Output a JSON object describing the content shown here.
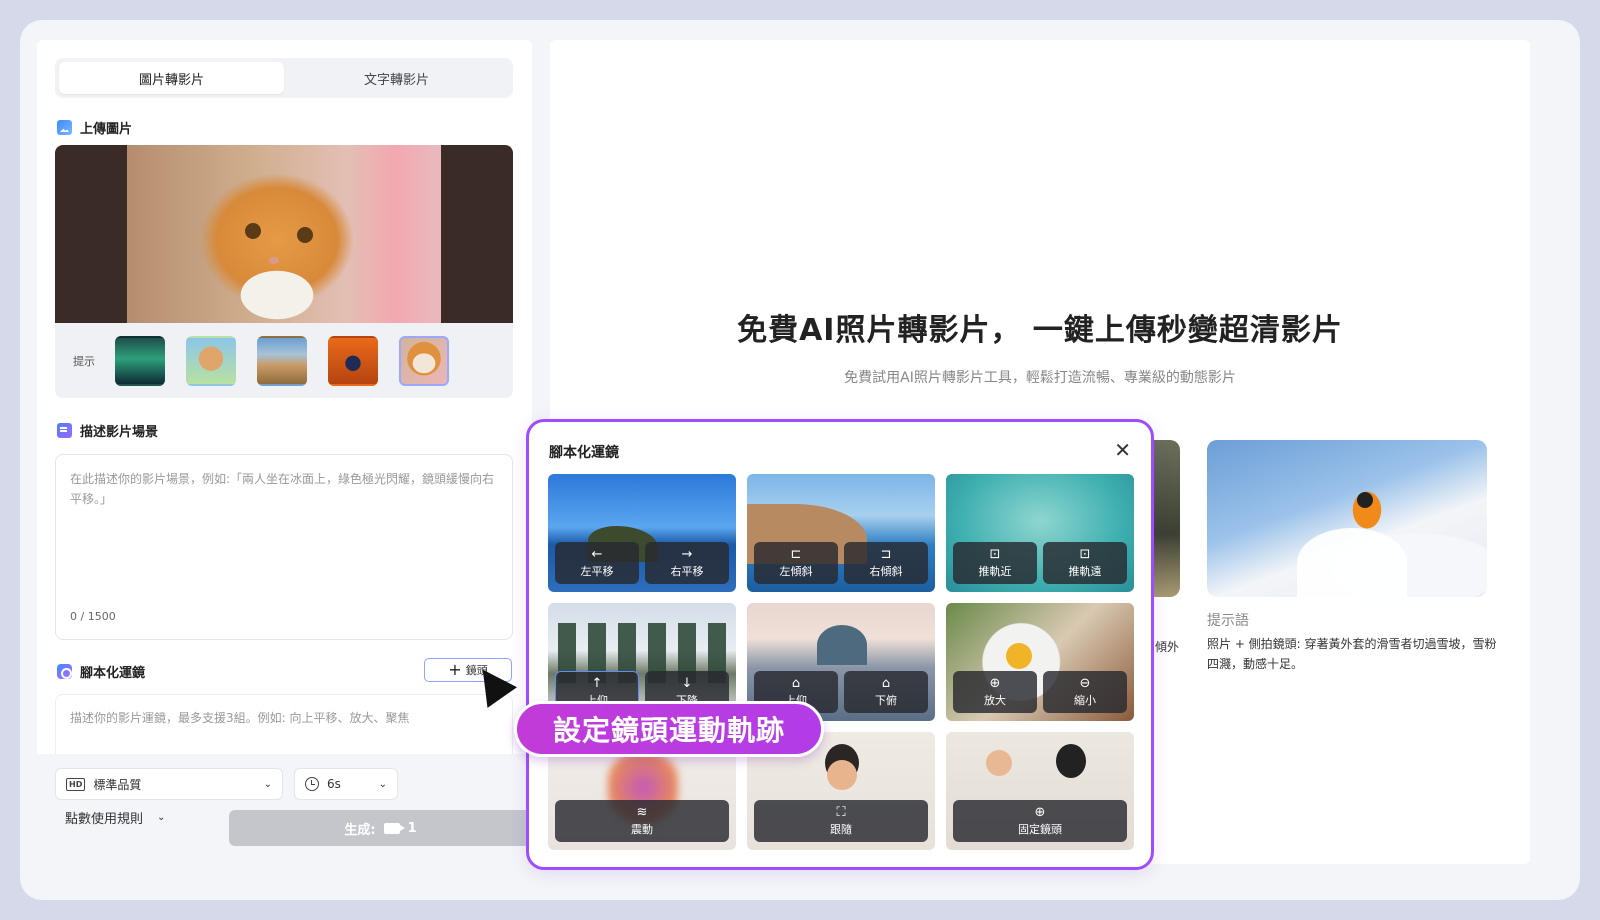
{
  "tabs": [
    {
      "label": "圖片轉影片",
      "active": true
    },
    {
      "label": "文字轉影片",
      "active": false
    }
  ],
  "upload": {
    "title": "上傳圖片",
    "hint_label": "提示",
    "thumbnails": [
      "aurora-thumb",
      "toy-figure-thumb",
      "motorbike-thumb",
      "chair-thumb",
      "cat-thumb"
    ]
  },
  "scene": {
    "title": "描述影片場景",
    "placeholder": "在此描述你的影片場景，例如:「兩人坐在冰面上，綠色極光閃耀，鏡頭緩慢向右平移。」",
    "counter": "0 / 1500"
  },
  "camera": {
    "title": "腳本化運鏡",
    "add_button": "鏡頭",
    "placeholder": "描述你的影片運鏡，最多支援3組。例如: 向上平移、放大、聚焦"
  },
  "settings": {
    "quality": "標準品質",
    "quality_badge": "HD",
    "duration": "6s",
    "rules": "點數使用規則",
    "generate_label": "生成:",
    "generate_cost": "1"
  },
  "hero": {
    "title": "免費AI照片轉影片， 一鍵上傳秒變超清影片",
    "subtitle": "免費試用AI照片轉影片工具，輕鬆打造流暢、專業級的動態影片"
  },
  "example": {
    "peek_text": "傾外",
    "label": "提示語",
    "description": "照片 + 側拍鏡頭: 穿著黃外套的滑雪者切過雪坡，雪粉四濺，動感十足。"
  },
  "modal": {
    "title": "腳本化運鏡",
    "close": "✕",
    "moves": [
      {
        "label": "左平移",
        "glyph": "←"
      },
      {
        "label": "右平移",
        "glyph": "→"
      },
      {
        "label": "左傾斜",
        "glyph": "⊏"
      },
      {
        "label": "右傾斜",
        "glyph": "⊐"
      },
      {
        "label": "推軌近",
        "glyph": "⊡"
      },
      {
        "label": "推軌遠",
        "glyph": "⊡"
      },
      {
        "label": "上仰",
        "glyph": "↑"
      },
      {
        "label": "下降",
        "glyph": "↓"
      },
      {
        "label": "上仰",
        "glyph": "⌂"
      },
      {
        "label": "下俯",
        "glyph": "⌂"
      },
      {
        "label": "放大",
        "glyph": "⊕"
      },
      {
        "label": "縮小",
        "glyph": "⊖"
      },
      {
        "label": "震動",
        "glyph": "≋"
      },
      {
        "label": "跟隨",
        "glyph": "⛶"
      },
      {
        "label": "固定鏡頭",
        "glyph": "⊕"
      }
    ]
  },
  "banner": "設定鏡頭運動軌跡",
  "colors": {
    "accent": "#9d4dff",
    "banner": "#c23bd8",
    "primary_border": "#8ea6ff"
  }
}
